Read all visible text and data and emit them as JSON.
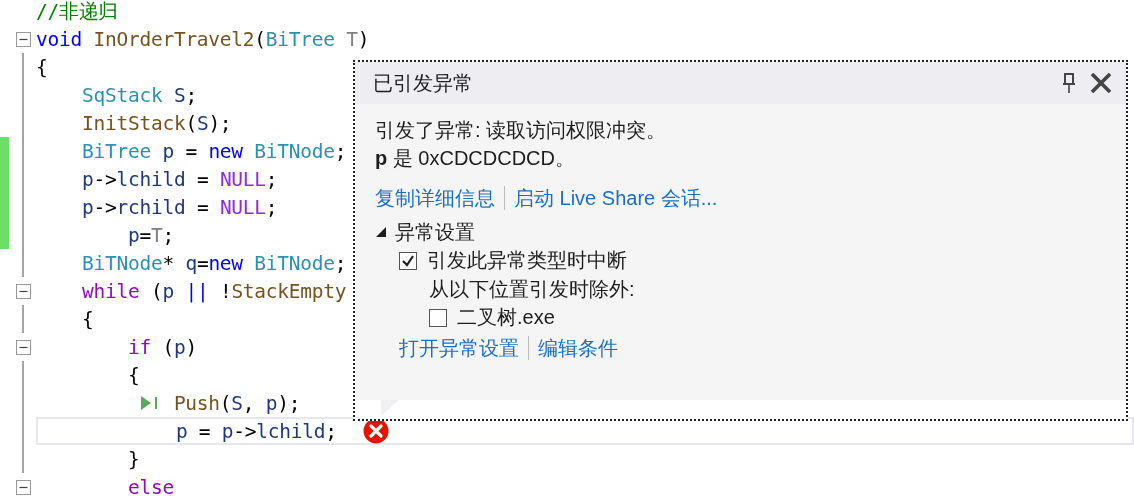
{
  "editor": {
    "lines": [
      {
        "fold": false,
        "changed": false,
        "tokens": [
          {
            "text": "//非递归",
            "kind": "comment"
          }
        ]
      },
      {
        "fold": true,
        "changed": false,
        "tokens": [
          {
            "text": "void",
            "kind": "keyword"
          },
          {
            "text": " InOrderTravel2",
            "kind": "func"
          },
          {
            "text": "(",
            "kind": "punct"
          },
          {
            "text": "BiTree",
            "kind": "type"
          },
          {
            "text": " T",
            "kind": "param"
          },
          {
            "text": ")",
            "kind": "punct"
          }
        ]
      },
      {
        "fold": false,
        "changed": false,
        "tokens": [
          {
            "text": "{",
            "kind": "punct"
          }
        ]
      },
      {
        "fold": false,
        "changed": false,
        "tokens": [
          {
            "text": "    SqStack",
            "kind": "type"
          },
          {
            "text": " S",
            "kind": "var"
          },
          {
            "text": ";",
            "kind": "punct"
          }
        ]
      },
      {
        "fold": false,
        "changed": false,
        "tokens": [
          {
            "text": "    InitStack",
            "kind": "func"
          },
          {
            "text": "(",
            "kind": "punct"
          },
          {
            "text": "S",
            "kind": "var"
          },
          {
            "text": ");",
            "kind": "punct"
          }
        ]
      },
      {
        "fold": false,
        "changed": true,
        "tokens": [
          {
            "text": "    BiTree",
            "kind": "type"
          },
          {
            "text": " p",
            "kind": "var"
          },
          {
            "text": " = ",
            "kind": "punct"
          },
          {
            "text": "new",
            "kind": "keyword"
          },
          {
            "text": " BiTNode",
            "kind": "type"
          },
          {
            "text": ";",
            "kind": "punct"
          }
        ]
      },
      {
        "fold": false,
        "changed": true,
        "tokens": [
          {
            "text": "    p",
            "kind": "var"
          },
          {
            "text": "->",
            "kind": "punct"
          },
          {
            "text": "lchild",
            "kind": "var"
          },
          {
            "text": " = ",
            "kind": "punct"
          },
          {
            "text": "NULL",
            "kind": "macro"
          },
          {
            "text": ";",
            "kind": "punct"
          }
        ]
      },
      {
        "fold": false,
        "changed": true,
        "tokens": [
          {
            "text": "    p",
            "kind": "var"
          },
          {
            "text": "->",
            "kind": "punct"
          },
          {
            "text": "rchild",
            "kind": "var"
          },
          {
            "text": " = ",
            "kind": "punct"
          },
          {
            "text": "NULL",
            "kind": "macro"
          },
          {
            "text": ";",
            "kind": "punct"
          }
        ]
      },
      {
        "fold": false,
        "changed": true,
        "tokens": [
          {
            "text": "        p",
            "kind": "var"
          },
          {
            "text": "=",
            "kind": "punct"
          },
          {
            "text": "T",
            "kind": "param"
          },
          {
            "text": ";",
            "kind": "punct"
          }
        ]
      },
      {
        "fold": false,
        "changed": false,
        "tokens": [
          {
            "text": "    BiTNode",
            "kind": "type"
          },
          {
            "text": "* ",
            "kind": "punct"
          },
          {
            "text": "q",
            "kind": "var"
          },
          {
            "text": "=",
            "kind": "punct"
          },
          {
            "text": "new",
            "kind": "keyword"
          },
          {
            "text": " BiTNode",
            "kind": "type"
          },
          {
            "text": ";",
            "kind": "punct"
          }
        ]
      },
      {
        "fold": true,
        "changed": false,
        "tokens": [
          {
            "text": "    while",
            "kind": "control"
          },
          {
            "text": " (",
            "kind": "punct"
          },
          {
            "text": "p",
            "kind": "var"
          },
          {
            "text": " ||",
            "kind": "keyword"
          },
          {
            "text": " !",
            "kind": "punct"
          },
          {
            "text": "StackEmpty",
            "kind": "func"
          }
        ]
      },
      {
        "fold": false,
        "changed": false,
        "tokens": [
          {
            "text": "    {",
            "kind": "punct"
          }
        ]
      },
      {
        "fold": true,
        "changed": false,
        "tokens": [
          {
            "text": "        if",
            "kind": "control"
          },
          {
            "text": " (",
            "kind": "punct"
          },
          {
            "text": "p",
            "kind": "var"
          },
          {
            "text": ")",
            "kind": "punct"
          }
        ]
      },
      {
        "fold": false,
        "changed": false,
        "tokens": [
          {
            "text": "        {",
            "kind": "punct"
          }
        ]
      },
      {
        "fold": false,
        "changed": false,
        "next_statement": true,
        "tokens": [
          {
            "text": "            Push",
            "kind": "func"
          },
          {
            "text": "(",
            "kind": "punct"
          },
          {
            "text": "S",
            "kind": "var"
          },
          {
            "text": ", ",
            "kind": "punct"
          },
          {
            "text": "p",
            "kind": "var"
          },
          {
            "text": ");",
            "kind": "punct"
          }
        ]
      },
      {
        "fold": false,
        "changed": false,
        "current": true,
        "error": true,
        "tokens": [
          {
            "text": "            p",
            "kind": "var"
          },
          {
            "text": " = ",
            "kind": "punct"
          },
          {
            "text": "p",
            "kind": "var"
          },
          {
            "text": "->",
            "kind": "punct"
          },
          {
            "text": "lchild",
            "kind": "var"
          },
          {
            "text": ";",
            "kind": "punct"
          }
        ]
      },
      {
        "fold": false,
        "changed": false,
        "tokens": [
          {
            "text": "        }",
            "kind": "punct"
          }
        ]
      },
      {
        "fold": true,
        "changed": false,
        "tokens": [
          {
            "text": "        else",
            "kind": "control"
          }
        ]
      }
    ]
  },
  "exception_popup": {
    "title": "已引发异常",
    "message": "引发了异常: 读取访问权限冲突。",
    "detail": "**p** 是 0xCDCDCDCD。",
    "links": [
      "复制详细信息",
      "启动 Live Share 会话..."
    ],
    "settings": {
      "label": "异常设置",
      "expanded": true,
      "break_option": {
        "label": "引发此异常类型时中断",
        "checked": true
      },
      "except_label": "从以下位置引发时除外:",
      "exceptions": [
        {
          "label": "二叉树.exe",
          "checked": false
        }
      ],
      "links": [
        "打开异常设置",
        "编辑条件"
      ]
    }
  }
}
